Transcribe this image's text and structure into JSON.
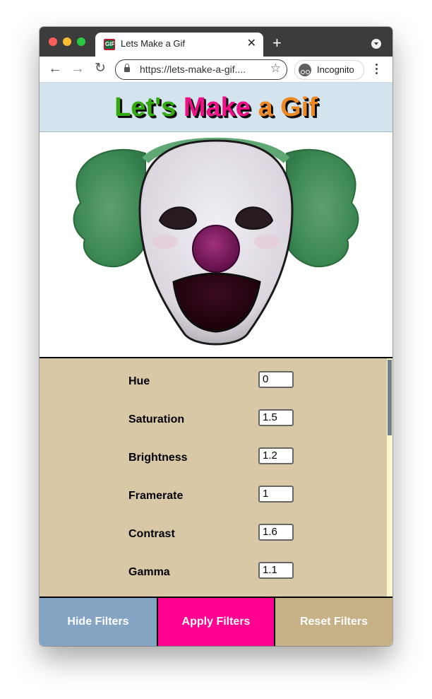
{
  "browser": {
    "tab_title": "Lets Make a Gif",
    "favicon_text": "GIF",
    "tab_close": "✕",
    "new_tab": "+",
    "url": "https://lets-make-a-gif....",
    "incognito_label": "Incognito",
    "back_glyph": "←",
    "forward_glyph": "→",
    "reload_glyph": "↻",
    "star_glyph": "☆"
  },
  "site": {
    "title_part1": "Let's",
    "title_part2": "Make",
    "title_part3": "a Gif",
    "title_colors": [
      "#33aa11",
      "#ee1188",
      "#ee8822"
    ]
  },
  "filters": [
    {
      "label": "Hue",
      "value": "0"
    },
    {
      "label": "Saturation",
      "value": "1.5"
    },
    {
      "label": "Brightness",
      "value": "1.2"
    },
    {
      "label": "Framerate",
      "value": "1"
    },
    {
      "label": "Contrast",
      "value": "1.6"
    },
    {
      "label": "Gamma",
      "value": "1.1"
    }
  ],
  "buttons": {
    "hide": "Hide Filters",
    "apply": "Apply Filters",
    "reset": "Reset Filters"
  },
  "colors": {
    "banner_bg": "#d4e4ee",
    "panel_bg": "#d8c8a6",
    "hide_btn": "#84a4c4",
    "apply_btn": "#ff0090",
    "reset_btn": "#c6b085"
  },
  "icons": {
    "preview_image": "clown-face-image",
    "lock": "lock-icon",
    "incognito": "incognito-icon",
    "menu": "kebab-menu-icon"
  }
}
